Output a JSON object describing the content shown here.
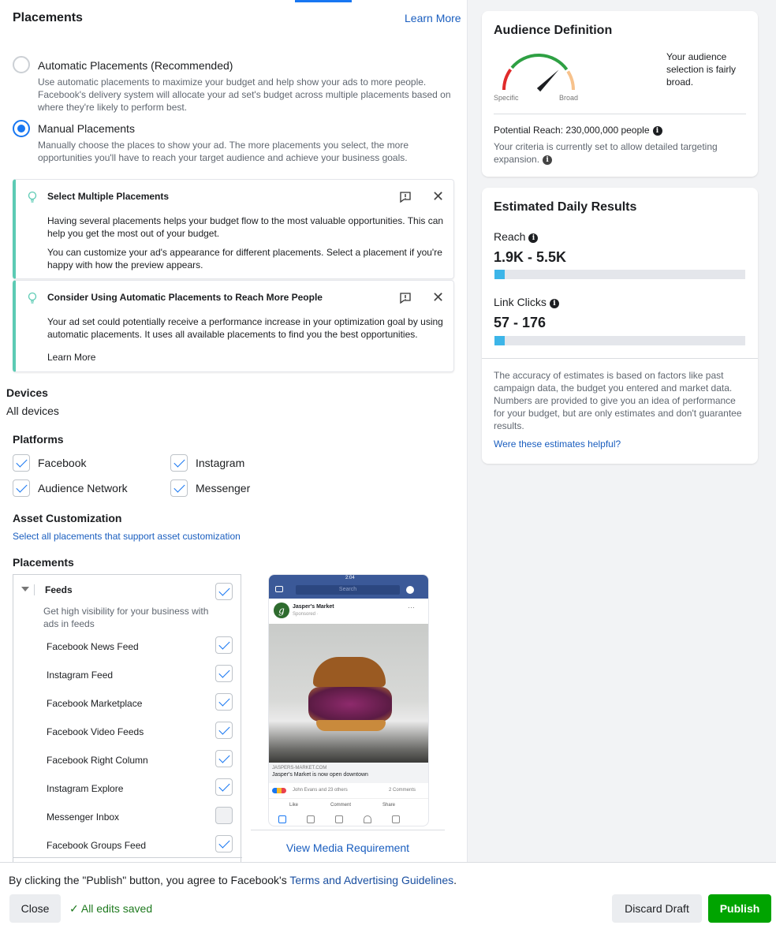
{
  "placements": {
    "title": "Placements",
    "learn_more": "Learn More",
    "automatic": {
      "label": "Automatic Placements (Recommended)",
      "desc": "Use automatic placements to maximize your budget and help show your ads to more people. Facebook's delivery system will allocate your ad set's budget across multiple placements based on where they're likely to perform best.",
      "selected": false
    },
    "manual": {
      "label": "Manual Placements",
      "desc": "Manually choose the places to show your ad. The more placements you select, the more opportunities you'll have to reach your target audience and achieve your business goals.",
      "selected": true
    }
  },
  "tips": [
    {
      "title": "Select Multiple Placements",
      "p1": "Having several placements helps your budget flow to the most valuable opportunities. This can help you get the most out of your budget.",
      "p2": "You can customize your ad's appearance for different placements. Select a placement if you're happy with how the preview appears."
    },
    {
      "title": "Consider Using Automatic Placements to Reach More People",
      "p1": "Your ad set could potentially receive a performance increase in your optimization goal by using automatic placements. It uses all available placements to find you the best opportunities.",
      "link": "Learn More"
    }
  ],
  "devices": {
    "title": "Devices",
    "value": "All devices"
  },
  "platforms": {
    "title": "Platforms",
    "items": [
      {
        "label": "Facebook",
        "checked": true
      },
      {
        "label": "Instagram",
        "checked": true
      },
      {
        "label": "Audience Network",
        "checked": true
      },
      {
        "label": "Messenger",
        "checked": true
      }
    ]
  },
  "asset": {
    "title": "Asset Customization",
    "link": "Select all placements that support asset customization"
  },
  "placement_list": {
    "title": "Placements",
    "group": "Feeds",
    "group_desc": "Get high visibility for your business with ads in feeds",
    "items": [
      {
        "label": "Facebook News Feed",
        "checked": true
      },
      {
        "label": "Instagram Feed",
        "checked": true
      },
      {
        "label": "Facebook Marketplace",
        "checked": true
      },
      {
        "label": "Facebook Video Feeds",
        "checked": true
      },
      {
        "label": "Facebook Right Column",
        "checked": true
      },
      {
        "label": "Instagram Explore",
        "checked": true
      },
      {
        "label": "Messenger Inbox",
        "checked": false
      },
      {
        "label": "Facebook Groups Feed",
        "checked": true
      }
    ]
  },
  "preview": {
    "time": "2:04",
    "search": "Search",
    "page": "Jasper's Market",
    "sponsored": "Sponsored · ",
    "domain": "JASPERS-MARKET.COM",
    "headline": "Jasper's Market is now open downtown",
    "reactions": "John Evans and 23 others",
    "comments": "2 Comments",
    "like": "Like",
    "comment": "Comment",
    "share": "Share",
    "media_link": "View Media Requirement"
  },
  "audience": {
    "title": "Audience Definition",
    "specific": "Specific",
    "broad": "Broad",
    "summary": "Your audience selection is fairly broad.",
    "reach": "Potential Reach: 230,000,000 people",
    "criteria": "Your criteria is currently set to allow detailed targeting expansion.",
    "gauge_level": 0.75,
    "colors": {
      "red": "#e02b2b",
      "green": "#2ea043",
      "orange": "#f7c28c"
    }
  },
  "estimates": {
    "title": "Estimated Daily Results",
    "reach_label": "Reach",
    "reach_value": "1.9K - 5.5K",
    "reach_fill_pct": 4,
    "clicks_label": "Link Clicks",
    "clicks_value": "57 - 176",
    "clicks_fill_pct": 4,
    "note": "The accuracy of estimates is based on factors like past campaign data, the budget you entered and market data. Numbers are provided to give you an idea of performance for your budget, but are only estimates and don't guarantee results.",
    "helpful": "Were these estimates helpful?"
  },
  "footer": {
    "agree_prefix": "By clicking the \"Publish\" button, you agree to Facebook's ",
    "agree_link": "Terms and Advertising Guidelines",
    "agree_suffix": ".",
    "close": "Close",
    "saved": "All edits saved",
    "discard": "Discard Draft",
    "publish": "Publish"
  },
  "colors": {
    "accent": "#1877f2",
    "publish": "#00a400",
    "tip_border": "#5ccbb4"
  }
}
